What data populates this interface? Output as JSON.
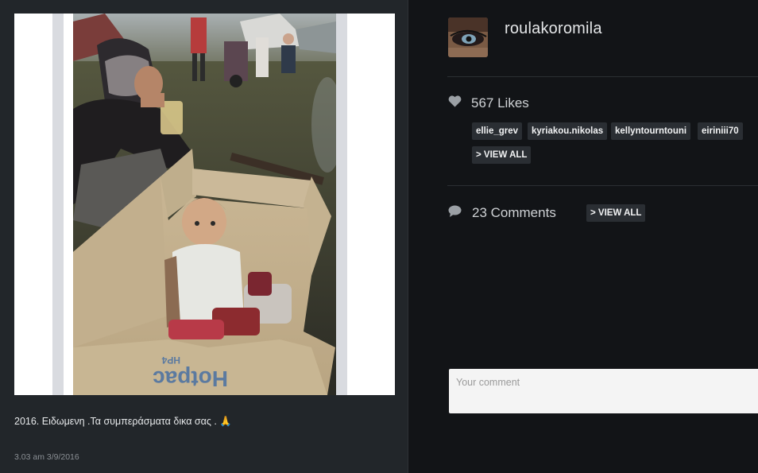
{
  "post": {
    "caption": "2016. Ειδωμενη .Τα συμπεράσματα δικα σας . 🙏",
    "timestamp": "3.03 am 3/9/2016",
    "image_alt": "Woman eating beside a baby sitting in a cardboard box at a camp",
    "box_print": "Hotpac HP4"
  },
  "profile": {
    "username": "roulakoromila"
  },
  "likes": {
    "count_label": "567 Likes",
    "users": [
      "ellie_grev",
      "kyriakou.nikolas",
      "kellyntourntouni",
      "eiriniii70"
    ],
    "view_all_label": "> VIEW ALL"
  },
  "comments": {
    "count_label": "23 Comments",
    "view_all_label": "> VIEW ALL",
    "input_placeholder": "Your comment"
  },
  "icons": {
    "likes": "heart-icon",
    "comments": "speech-bubble-icon"
  },
  "colors": {
    "background": "#121417",
    "panel": "#22262a",
    "tag_bg": "#2a2e33",
    "text": "#d7d9dc"
  }
}
